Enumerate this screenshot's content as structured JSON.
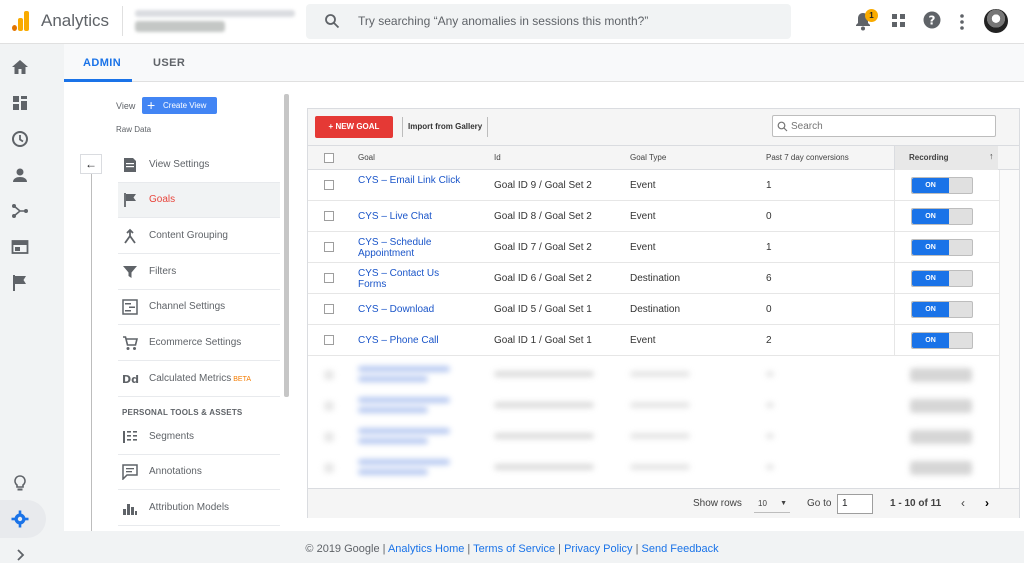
{
  "header": {
    "app_title": "Analytics",
    "search_placeholder": "Try searching “Any anomalies in sessions this month?”",
    "notification_count": "1",
    "icons": [
      "notifications-icon",
      "apps-grid-icon",
      "help-icon",
      "more-vert-icon",
      "avatar"
    ]
  },
  "rail": {
    "items": [
      "home-icon",
      "customization-icon",
      "realtime-icon",
      "audience-icon",
      "acquisition-icon",
      "behavior-icon",
      "conversions-icon",
      "discover-icon",
      "admin-gear-icon",
      "expand-icon"
    ]
  },
  "tabs": {
    "admin": "ADMIN",
    "user": "USER"
  },
  "view_column": {
    "view_label": "View",
    "create_view": "Create View",
    "view_name": "Raw Data",
    "items": [
      {
        "label": "View Settings",
        "icon": "view-settings-icon"
      },
      {
        "label": "Goals",
        "icon": "flag-icon",
        "active": true
      },
      {
        "label": "Content Grouping",
        "icon": "content-grouping-icon"
      },
      {
        "label": "Filters",
        "icon": "filter-icon"
      },
      {
        "label": "Channel Settings",
        "icon": "channel-settings-icon"
      },
      {
        "label": "Ecommerce Settings",
        "icon": "cart-icon"
      },
      {
        "label": "Calculated Metrics",
        "icon": "calculated-metrics-icon",
        "badge": "BETA"
      }
    ],
    "tools_title": "PERSONAL TOOLS & ASSETS",
    "tools": [
      {
        "label": "Segments",
        "icon": "segments-icon"
      },
      {
        "label": "Annotations",
        "icon": "annotations-icon"
      },
      {
        "label": "Attribution Models",
        "icon": "attribution-icon"
      }
    ]
  },
  "goals": {
    "new_goal_label": "+ NEW GOAL",
    "import_label": "Import from Gallery",
    "search_placeholder": "Search",
    "columns": {
      "goal": "Goal",
      "id": "Id",
      "type": "Goal Type",
      "conversions": "Past 7 day conversions",
      "recording": "Recording",
      "sort_arrow": "↑"
    },
    "toggle_label": "ON",
    "rows": [
      {
        "goal": "CYS – Email Link Click",
        "id": "Goal ID 9 / Goal Set 2",
        "type": "Event",
        "conversions": "1"
      },
      {
        "goal": "CYS – Live Chat",
        "id": "Goal ID 8 / Goal Set 2",
        "type": "Event",
        "conversions": "0"
      },
      {
        "goal": "CYS – Schedule Appointment",
        "id": "Goal ID 7 / Goal Set 2",
        "type": "Event",
        "conversions": "1"
      },
      {
        "goal": "CYS – Contact Us Forms",
        "id": "Goal ID 6 / Goal Set 2",
        "type": "Destination",
        "conversions": "6"
      },
      {
        "goal": "CYS – Download",
        "id": "Goal ID 5 / Goal Set 1",
        "type": "Destination",
        "conversions": "0"
      },
      {
        "goal": "CYS – Phone Call",
        "id": "Goal ID 1 / Goal Set 1",
        "type": "Event",
        "conversions": "2"
      }
    ],
    "show_rows_label": "Show rows",
    "rows_per_page": "10",
    "goto_label": "Go to",
    "goto_value": "1",
    "page_range": "1 - 10 of 11",
    "prev": "‹",
    "next": "›"
  },
  "footer": {
    "copyright": "© 2019 Google |",
    "links": [
      "Analytics Home",
      "Terms of Service",
      "Privacy Policy",
      "Send Feedback"
    ],
    "sep": " | "
  },
  "colors": {
    "accent": "#1a73e8",
    "new_goal": "#e53935",
    "active_nav": "#e8453c",
    "brand": "#f9ab00"
  }
}
